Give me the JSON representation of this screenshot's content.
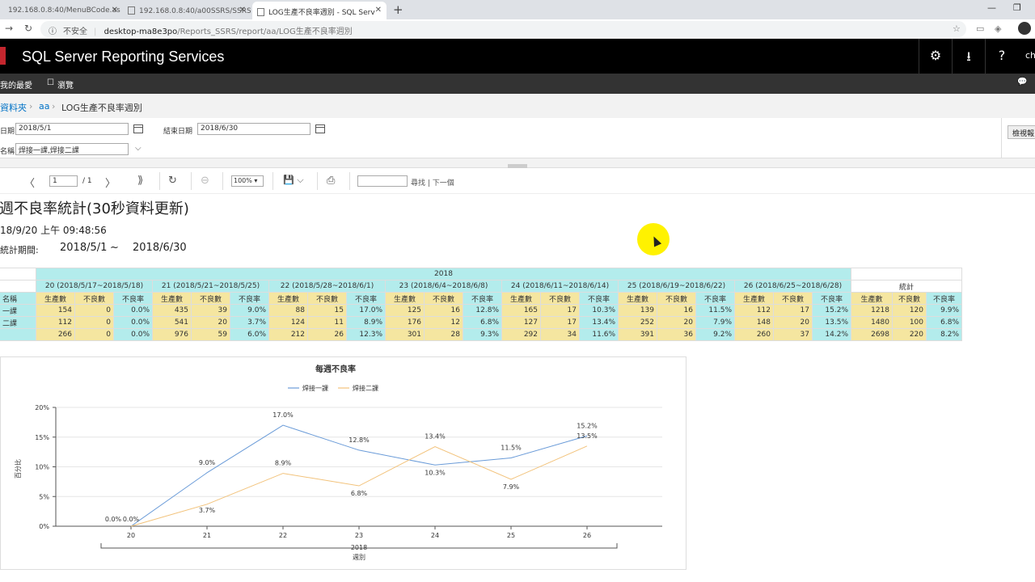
{
  "browser": {
    "tabs": [
      {
        "label": "192.168.0.8:40/MenuBCode.as"
      },
      {
        "label": "192.168.0.8:40/a00SSRS/SSRS"
      },
      {
        "label": "LOG生產不良率週別 - SQL Serv"
      }
    ],
    "new_tab": "+",
    "address": {
      "insecure_label": "不安全",
      "host": "desktop-ma8e3po",
      "path": "/Reports_SSRS/report/aa/LOG生產不良率週別"
    },
    "win_min": "—",
    "win_max": "❐"
  },
  "ssrs": {
    "title": "SQL Server Reporting Services",
    "settings_icon": "⚙",
    "download_icon": "⭳",
    "help_icon": "?",
    "user": "ch",
    "favorites": "我的最愛",
    "browse": "瀏覽",
    "browse_icon": "☐",
    "comment_icon": "💬"
  },
  "breadcrumb": {
    "root": "資料夾",
    "folder": "aa",
    "report": "LOG生產不良率週別"
  },
  "params": {
    "start_label": "日期",
    "start_value": "2018/5/1",
    "end_label": "結束日期",
    "end_value": "2018/6/30",
    "name_label": "名稱",
    "name_value": "焊接一課,焊接二課",
    "view_report": "檢視報"
  },
  "toolbar": {
    "prev": "〈",
    "next": "〉",
    "last": "⟫",
    "page": "1",
    "page_total": "/ 1",
    "refresh": "↻",
    "back": "⊖",
    "zoom": "100% ▾",
    "save": "💾 ⌵",
    "print": "⎙",
    "find_label": "尋找 | 下一個"
  },
  "report": {
    "title": "週不良率統計(30秒資料更新)",
    "timestamp": "18/9/20 上午 09:48:56",
    "period_label": "統計期間:",
    "period_start": "2018/5/1",
    "period_tilde": "~",
    "period_end": "2018/6/30"
  },
  "table": {
    "year": "2018",
    "weeks": [
      "20 (2018/5/17~2018/5/18)",
      "21 (2018/5/21~2018/5/25)",
      "22 (2018/5/28~2018/6/1)",
      "23 (2018/6/4~2018/6/8)",
      "24 (2018/6/11~2018/6/14)",
      "25 (2018/6/19~2018/6/22)",
      "26 (2018/6/25~2018/6/28)"
    ],
    "total_label": "統計",
    "name_header": "名稱",
    "col_headers": [
      "生產數",
      "不良數",
      "不良率"
    ],
    "rows": [
      {
        "name": "一課",
        "cells": [
          "154",
          "0",
          "0.0%",
          "435",
          "39",
          "9.0%",
          "88",
          "15",
          "17.0%",
          "125",
          "16",
          "12.8%",
          "165",
          "17",
          "10.3%",
          "139",
          "16",
          "11.5%",
          "112",
          "17",
          "15.2%",
          "1218",
          "120",
          "9.9%"
        ]
      },
      {
        "name": "二課",
        "cells": [
          "112",
          "0",
          "0.0%",
          "541",
          "20",
          "3.7%",
          "124",
          "11",
          "8.9%",
          "176",
          "12",
          "6.8%",
          "127",
          "17",
          "13.4%",
          "252",
          "20",
          "7.9%",
          "148",
          "20",
          "13.5%",
          "1480",
          "100",
          "6.8%"
        ]
      },
      {
        "name": "",
        "cells": [
          "266",
          "0",
          "0.0%",
          "976",
          "59",
          "6.0%",
          "212",
          "26",
          "12.3%",
          "301",
          "28",
          "9.3%",
          "292",
          "34",
          "11.6%",
          "391",
          "36",
          "9.2%",
          "260",
          "37",
          "14.2%",
          "2698",
          "220",
          "8.2%"
        ]
      }
    ]
  },
  "chart_data": {
    "type": "line",
    "title": "每週不良率",
    "xlabel": "週別",
    "x_group_label": "2018",
    "ylabel": "百分比",
    "categories": [
      "20",
      "21",
      "22",
      "23",
      "24",
      "25",
      "26"
    ],
    "ylim": [
      0,
      20
    ],
    "yticks": [
      "0%",
      "5%",
      "10%",
      "15%",
      "20%"
    ],
    "legend_position": "top",
    "series": [
      {
        "name": "焊接一課",
        "color": "#6a9bd8",
        "values": [
          0.0,
          9.0,
          17.0,
          12.8,
          10.3,
          11.5,
          15.2
        ],
        "labels": [
          "0.0%",
          "9.0%",
          "17.0%",
          "12.8%",
          "10.3%",
          "11.5%",
          "15.2%"
        ]
      },
      {
        "name": "焊接二課",
        "color": "#f2c27a",
        "values": [
          0.0,
          3.7,
          8.9,
          6.8,
          13.4,
          7.9,
          13.5
        ],
        "labels": [
          "0.0%",
          "3.7%",
          "8.9%",
          "6.8%",
          "13.4%",
          "7.9%",
          "13.5%"
        ]
      }
    ]
  }
}
